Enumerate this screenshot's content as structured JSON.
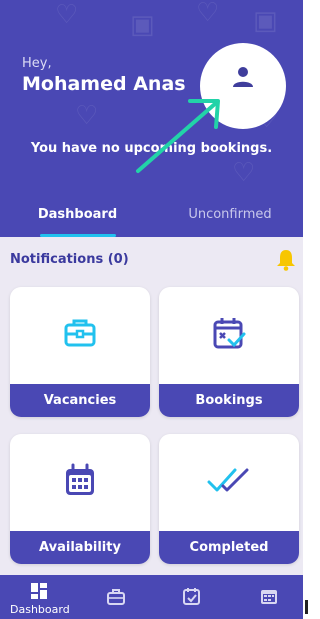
{
  "header": {
    "greeting": "Hey,",
    "user_name": "Mohamed Anas",
    "no_bookings_text": "You have no upcoming bookings.",
    "tabs": [
      {
        "label": "Dashboard",
        "active": true
      },
      {
        "label": "Unconfirmed",
        "active": false
      }
    ]
  },
  "notifications": {
    "label": "Notifications (0)"
  },
  "cards": [
    {
      "label": "Vacancies",
      "icon": "briefcase-icon"
    },
    {
      "label": "Bookings",
      "icon": "calendar-check-icon"
    },
    {
      "label": "Availability",
      "icon": "calendar-grid-icon"
    },
    {
      "label": "Completed",
      "icon": "double-check-icon"
    }
  ],
  "bottom_nav": {
    "items": [
      {
        "label": "Dashboard",
        "icon": "dashboard-icon"
      },
      {
        "icon": "briefcase-icon"
      },
      {
        "icon": "calendar-check-icon"
      },
      {
        "icon": "calendar-icon"
      }
    ]
  },
  "colors": {
    "primary": "#4a48b4",
    "accent": "#21c1ee",
    "bell": "#f7c600",
    "annotation_arrow": "#22d3a8"
  }
}
